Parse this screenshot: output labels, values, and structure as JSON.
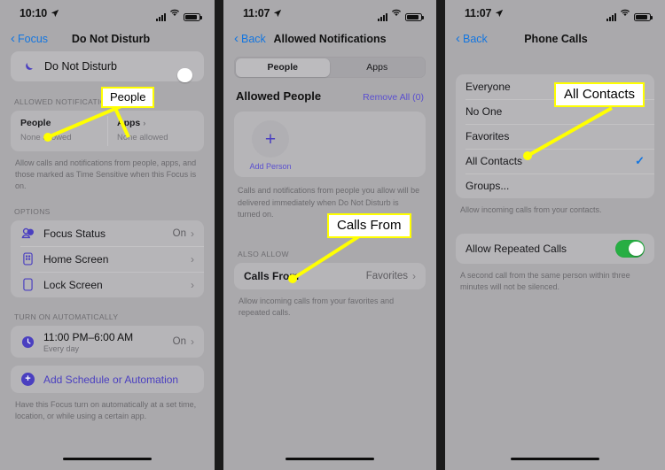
{
  "panels": [
    {
      "id": "do-not-disturb",
      "status": {
        "time": "10:10",
        "location_icon": "location-arrow-icon",
        "signal_icon": "cellular-signal-icon",
        "wifi_icon": "wifi-icon",
        "battery_icon": "battery-icon"
      },
      "nav": {
        "back_label": "Focus",
        "title": "Do Not Disturb"
      },
      "dnd": {
        "icon": "moon-icon",
        "label": "Do Not Disturb",
        "toggle_on": true
      },
      "allowed_section": {
        "header": "ALLOWED NOTIFICATIONS",
        "columns": [
          {
            "title": "People",
            "chevron": "",
            "subtitle": "None allowed"
          },
          {
            "title": "Apps",
            "chevron": "›",
            "subtitle": "None allowed"
          }
        ],
        "footnote": "Allow calls and notifications from people, apps, and those marked as Time Sensitive when this Focus is on."
      },
      "options_section": {
        "header": "OPTIONS",
        "rows": [
          {
            "icon": "focus-status-icon",
            "label": "Focus Status",
            "value": "On",
            "chevron": "›"
          },
          {
            "icon": "home-screen-icon",
            "label": "Home Screen",
            "value": "",
            "chevron": "›"
          },
          {
            "icon": "lock-screen-icon",
            "label": "Lock Screen",
            "value": "",
            "chevron": "›"
          }
        ]
      },
      "automation_section": {
        "header": "TURN ON AUTOMATICALLY",
        "schedule": {
          "icon": "clock-icon",
          "time": "11:00 PM–6:00 AM",
          "subtitle": "Every day",
          "value": "On",
          "chevron": "›"
        },
        "add_row": {
          "icon": "plus-circle-icon",
          "label": "Add Schedule or Automation"
        },
        "footnote": "Have this Focus turn on automatically at a set time, location, or while using a certain app."
      }
    },
    {
      "id": "allowed-notifications",
      "status": {
        "time": "11:07"
      },
      "nav": {
        "back_label": "Back",
        "title": "Allowed Notifications"
      },
      "segmented": {
        "options": [
          "People",
          "Apps"
        ],
        "selected": "People"
      },
      "section": {
        "title": "Allowed People",
        "action": "Remove All (0)"
      },
      "add_person": {
        "icon": "plus-icon",
        "label": "Add Person"
      },
      "paragraph": "Calls and notifications from people you allow will be delivered immediately when Do Not Disturb is turned on.",
      "also_allow": {
        "header": "ALSO ALLOW",
        "row": {
          "label": "Calls From",
          "value": "Favorites",
          "chevron": "›"
        },
        "footnote": "Allow incoming calls from your favorites and repeated calls."
      }
    },
    {
      "id": "phone-calls",
      "status": {
        "time": "11:07"
      },
      "nav": {
        "back_label": "Back",
        "title": "Phone Calls"
      },
      "choices": [
        {
          "label": "Everyone",
          "checked": false
        },
        {
          "label": "No One",
          "checked": false
        },
        {
          "label": "Favorites",
          "checked": false
        },
        {
          "label": "All Contacts",
          "checked": true
        },
        {
          "label": "Groups...",
          "checked": false
        }
      ],
      "choices_footnote": "Allow incoming calls from your contacts.",
      "repeated": {
        "label": "Allow Repeated Calls",
        "toggle_on": true
      },
      "repeated_footnote": "A second call from the same person within three minutes will not be silenced."
    }
  ],
  "annotations": [
    {
      "id": "callout-people",
      "text": "People"
    },
    {
      "id": "callout-calls-from",
      "text": "Calls From"
    },
    {
      "id": "callout-all-contacts",
      "text": "All Contacts"
    }
  ],
  "colors": {
    "accent_blue": "#1476e0",
    "accent_purple": "#4a3fc0",
    "toggle_green": "#27ae43",
    "callout_yellow": "#ffff00",
    "panel_bg": "#aaa9ac"
  }
}
